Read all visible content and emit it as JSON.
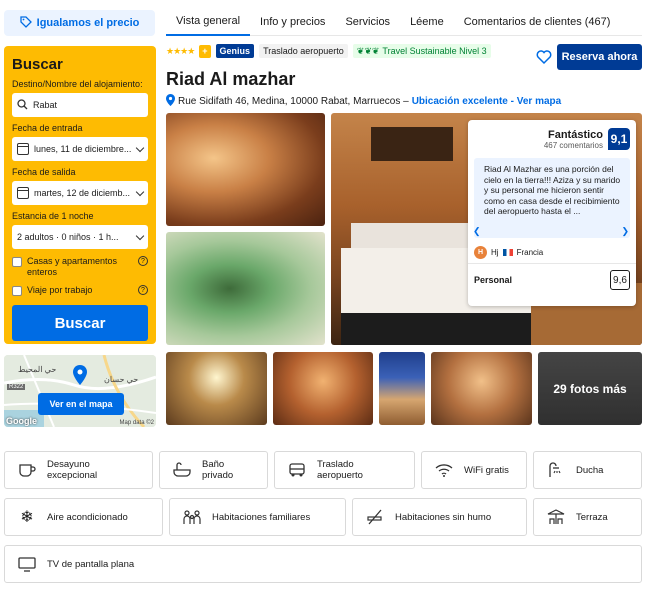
{
  "price_match": {
    "label": "Igualamos el precio"
  },
  "search": {
    "title": "Buscar",
    "destination_label": "Destino/Nombre del alojamiento:",
    "destination_value": "Rabat",
    "checkin_label": "Fecha de entrada",
    "checkin_value": "lunes, 11 de diciembre...",
    "checkout_label": "Fecha de salida",
    "checkout_value": "martes, 12 de diciemb...",
    "stay_label": "Estancia de 1 noche",
    "guests_value": "2 adultos · 0 niños · 1 h...",
    "option_homes": "Casas y apartamentos enteros",
    "option_work": "Viaje por trabajo",
    "button": "Buscar"
  },
  "map": {
    "button": "Ver en el mapa",
    "label_ar_1": "حي المحيط",
    "label_ar_2": "حي حسان",
    "label_road": "R322",
    "attribution": "Map data ©2"
  },
  "tabs": [
    {
      "label": "Vista general",
      "active": true
    },
    {
      "label": "Info y precios"
    },
    {
      "label": "Servicios"
    },
    {
      "label": "Léeme"
    },
    {
      "label": "Comentarios de clientes (467)"
    }
  ],
  "badges": {
    "stars": "★★★★",
    "plus": "+",
    "genius": "Genius",
    "transfer": "Traslado aeropuerto",
    "sustainable": "Travel Sustainable Nivel 3"
  },
  "header": {
    "reserve_button": "Reserva ahora",
    "hotel_name": "Riad Al mazhar",
    "address": "Rue Sidifath 46, Medina, 10000 Rabat, Marruecos –",
    "location_link": "Ubicación excelente - Ver mapa"
  },
  "review": {
    "rating_word": "Fantástico",
    "review_count": "467 comentarios",
    "score": "9,1",
    "quote": "Riad Al Mazhar es una porción del cielo en la tierra!!! Aziza y su marido y su personal me hicieron sentir como en casa desde el recibimiento del aeropuerto hasta el ...",
    "reviewer_initial": "H",
    "reviewer_name": "Hj",
    "reviewer_country": "Francia",
    "category": "Personal",
    "category_score": "9,6"
  },
  "photos": {
    "more_label": "29 fotos más"
  },
  "facilities": [
    {
      "label": "Desayuno excepcional",
      "icon": "coffee-cup-icon"
    },
    {
      "label": "Baño privado",
      "icon": "bath-icon"
    },
    {
      "label": "Traslado aeropuerto",
      "icon": "shuttle-icon"
    },
    {
      "label": "WiFi gratis",
      "icon": "wifi-icon"
    },
    {
      "label": "Ducha",
      "icon": "shower-icon"
    },
    {
      "label": "Aire acondicionado",
      "icon": "snowflake-icon"
    },
    {
      "label": "Habitaciones familiares",
      "icon": "family-icon"
    },
    {
      "label": "Habitaciones sin humo",
      "icon": "no-smoking-icon"
    },
    {
      "label": "Terraza",
      "icon": "terrace-icon"
    },
    {
      "label": "TV de pantalla plana",
      "icon": "tv-icon"
    }
  ],
  "colors": {
    "brand_blue": "#003b95",
    "link_blue": "#006ce4",
    "search_yellow": "#febb02",
    "sustainable_green": "#008234"
  }
}
